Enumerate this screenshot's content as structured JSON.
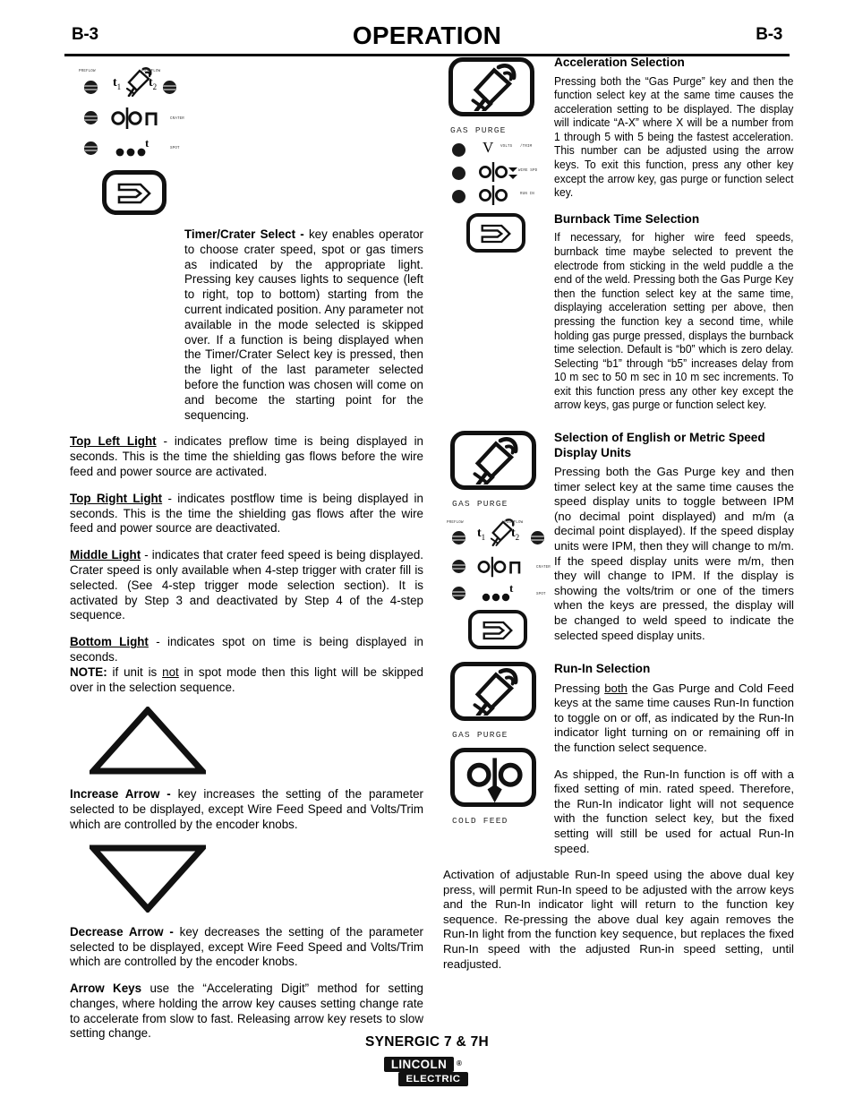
{
  "header": {
    "page_left": "B-3",
    "title": "OPERATION",
    "page_right": "B-3"
  },
  "left_column": {
    "panel_a": {
      "led_labels": {
        "preflow": "PREFLOW",
        "postflow": "POSTFLOW",
        "crater": "CRATER",
        "spot": "SPOT"
      },
      "timer_glyphs": {
        "t1": "t",
        "t1_sub": "1",
        "t2": "t",
        "t2_sub": "2",
        "spot_t": "t"
      },
      "select_key_name": "timer-crater-select-key"
    },
    "blocks": [
      {
        "lead": "Timer/Crater Select - ",
        "text": "key enables operator to choose crater speed, spot or gas timers as indicated by the appropriate light. Pressing key causes lights to sequence (left to right, top to bottom) starting from the current indicated position.  Any parameter not available in the mode selected is skipped over.  If a function is being displayed when the Timer/Crater Select key is pressed, then the light of the last parameter selected before the function was chosen will come on and become the starting point for the sequencing."
      },
      {
        "lead": "Top Left Light",
        "text": " - indicates preflow time is being displayed in seconds.  This is the time the shielding gas flows before the wire feed and power source are activated."
      },
      {
        "lead": "Top Right Light",
        "text": " - indicates postflow time is being displayed in seconds. This is the time the shielding gas flows after the wire feed and power source are deactivated."
      },
      {
        "lead": "Middle Light",
        "text": " - indicates that crater feed speed is being displayed. Crater speed is only available when 4-step trigger with crater fill is selected. (See 4-step trigger mode selection section). It is activated by Step 3 and deactivated by Step 4 of the 4-step sequence."
      },
      {
        "lead": "Bottom Light",
        "text": " - indicates spot on time is being displayed in seconds."
      }
    ],
    "note": {
      "label": "NOTE:",
      "text_before": "  if unit is ",
      "emphasis": "not",
      "text_after": " in spot mode then this light will be skipped over in the selection sequence."
    },
    "increase_arrow": {
      "lead": "Increase Arrow - ",
      "text": "key increases the setting of the parameter selected to be displayed, except Wire Feed Speed and Volts/Trim which are controlled by the encoder knobs."
    },
    "decrease_arrow": {
      "lead": "Decrease Arrow - ",
      "text": "key decreases the setting of the parameter selected to be displayed, except Wire Feed Speed and Volts/Trim which are controlled by the encoder knobs."
    },
    "arrow_keys": {
      "lead": "Arrow Keys ",
      "text": "use the “Accelerating Digit” method for setting changes, where holding the arrow key causes setting change rate to accelerate from slow to fast. Releasing arrow key resets to slow setting change."
    }
  },
  "right_column": {
    "panel_b": {
      "gas_purge_label": "GAS  PURGE",
      "volts_symbol": "V",
      "micro_labels": {
        "volts": "VOLTS",
        "trim": "/TRIM",
        "wire_speed": "WIRE SPD",
        "run_in": "RUN IN"
      }
    },
    "panel_c": {
      "gas_purge_label": "GAS  PURGE",
      "led_labels": {
        "preflow": "PREFLOW",
        "postflow": "POSTFLOW",
        "crater": "CRATER",
        "spot": "SPOT"
      }
    },
    "panel_d": {
      "gas_purge_label": "GAS  PURGE",
      "cold_feed_label": "COLD  FEED"
    },
    "sections": [
      {
        "heading": "Acceleration Selection",
        "paragraphs": [
          "Pressing both the “Gas Purge” key and then the function select key at the same time causes the acceleration setting to be displayed.  The display will   indicate “A-X” where X will be a number from 1 through 5 with 5 being the fastest acceleration.  This number can be adjusted using the arrow keys.  To exit this function, press any other key except the arrow key, gas purge or function select key."
        ]
      },
      {
        "heading": "Burnback Time Selection",
        "paragraphs": [
          "If necessary, for higher wire feed speeds, burnback time maybe selected to prevent the electrode from sticking in the weld puddle a the end of the weld. Pressing both the Gas Purge Key then the function select key at the same time, displaying acceleration setting per above, then pressing the function key a second time, while holding gas purge pressed, displays the burnback time selection.  Default is “b0” which is zero delay.  Selecting “b1” through “b5” increases delay from 10 m sec to 50 m sec in 10 m sec increments. To exit this function press any other key except the arrow keys, gas purge or function select key."
        ]
      },
      {
        "heading": "Selection of English or Metric Speed Display Units",
        "paragraphs": [
          "Pressing both the Gas Purge key and then timer select key at the same time causes the speed display units to toggle between IPM (no decimal point displayed) and m/m (a decimal point displayed).  If the speed display units were IPM, then they will change to m/m.  If the speed display units were m/m, then they will change to IPM.  If the display is showing the volts/trim or one of the timers when the keys are pressed, the display will be changed to weld speed to indicate the selected speed display units."
        ]
      },
      {
        "heading": "Run-In Selection",
        "paragraphs": [
          "Pressing both the Gas Purge and Cold Feed keys at the same time causes Run-In function to toggle on or off, as indicated by the Run-In indicator light turning on or remaining off in the function select sequence.",
          "As shipped, the Run-In function is off with a fixed setting of min. rated speed. Therefore, the Run-In indicator light will not sequence with the function select key, but the fixed setting will still be used for actual Run-In speed.",
          "Activation of adjustable Run-In speed using the above dual key press, will permit Run-In speed to be adjusted with the arrow keys and the Run-In indicator light will return to the function key sequence. Re-pressing the above dual key again removes the Run-In light from the function key sequence, but replaces the fixed Run-In speed with the adjusted Run-in speed setting, until readjusted."
        ],
        "run_in_underline": "both"
      }
    ]
  },
  "footer": {
    "product": "SYNERGIC 7 & 7H",
    "brand_top": "LINCOLN",
    "brand_reg": "®",
    "brand_bottom": "ELECTRIC"
  }
}
